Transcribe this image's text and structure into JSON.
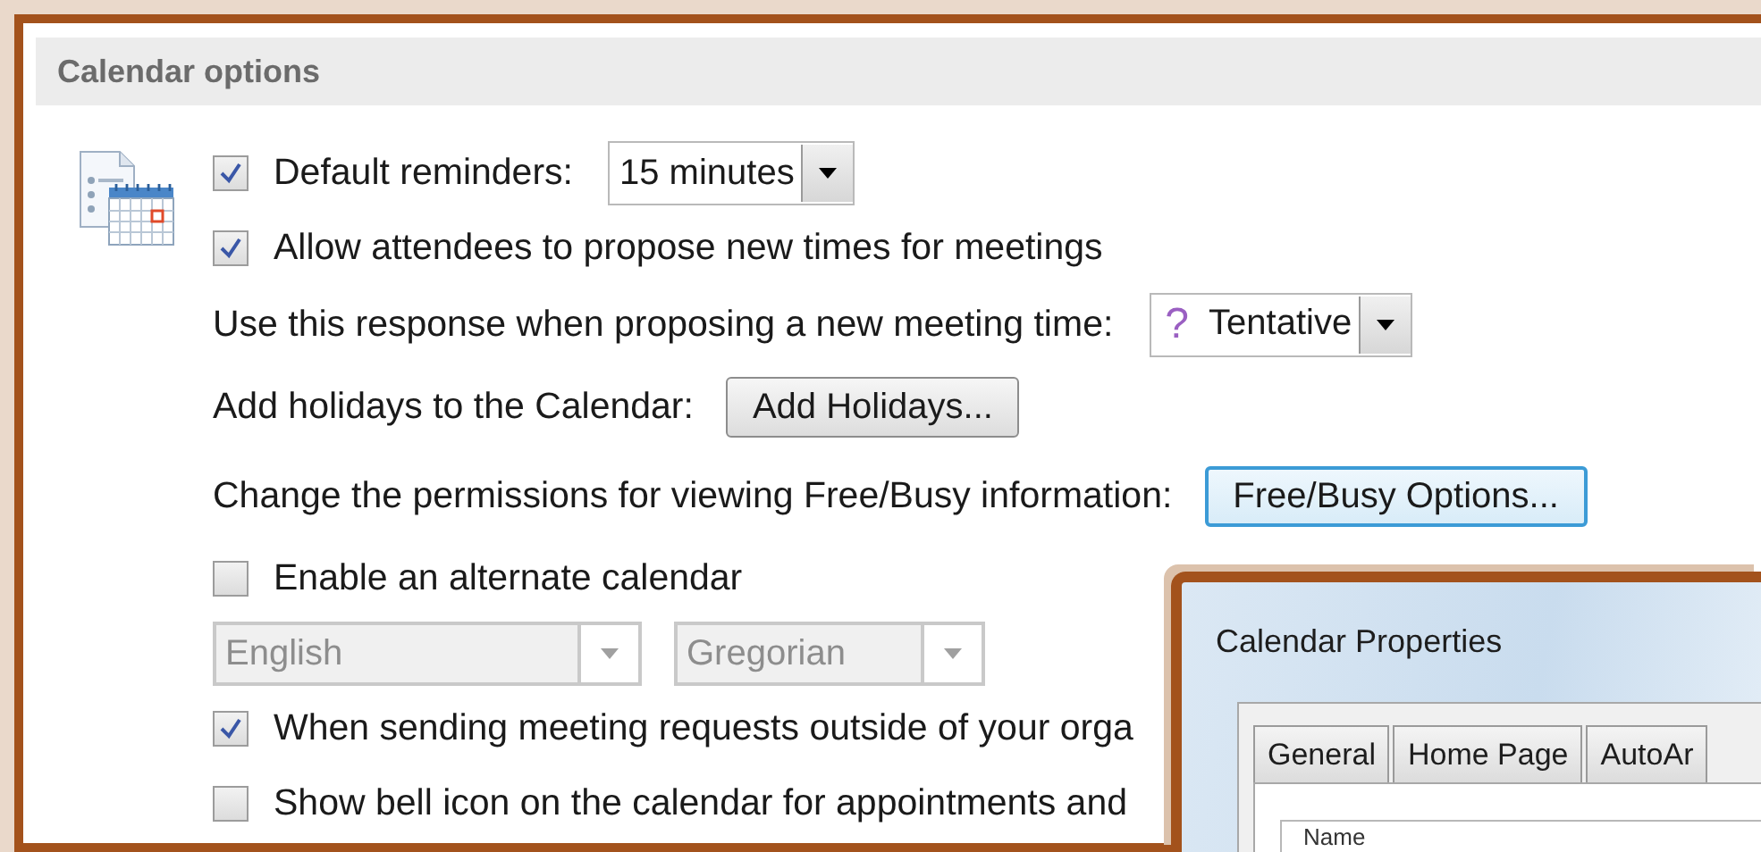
{
  "section_title": "Calendar options",
  "options": [
    {
      "kind": "checkbox",
      "label": "Default reminders:",
      "checked": true,
      "select": {
        "value": "15 minutes"
      }
    },
    {
      "kind": "checkbox",
      "label": "Allow attendees to propose new times for meetings",
      "checked": true
    },
    {
      "kind": "select",
      "label": "Use this response when proposing a new meeting time:",
      "select": {
        "icon_text": "?",
        "value": "Tentative"
      }
    },
    {
      "kind": "button",
      "label": "Add holidays to the Calendar:",
      "button": {
        "label": "Add Holidays...",
        "focused": false
      }
    },
    {
      "kind": "button",
      "label": "Change the permissions for viewing Free/Busy information:",
      "button": {
        "label": "Free/Busy Options...",
        "focused": true
      }
    },
    {
      "kind": "checkbox",
      "label": "Enable an alternate calendar",
      "checked": false
    },
    {
      "kind": "select_pair",
      "selects": [
        {
          "value": "English",
          "disabled": true
        },
        {
          "value": "Gregorian",
          "disabled": true
        }
      ]
    },
    {
      "kind": "checkbox",
      "label": "When sending meeting requests outside of your orga",
      "checked": true
    },
    {
      "kind": "checkbox",
      "label": "Show bell icon on the calendar for appointments and",
      "checked": false
    }
  ],
  "dialog": {
    "title": "Calendar Properties",
    "tabs": [
      {
        "label": "General",
        "selected": false
      },
      {
        "label": "Home Page",
        "selected": false
      },
      {
        "label": "AutoAr",
        "selected": false
      }
    ],
    "field_label": "Name"
  }
}
